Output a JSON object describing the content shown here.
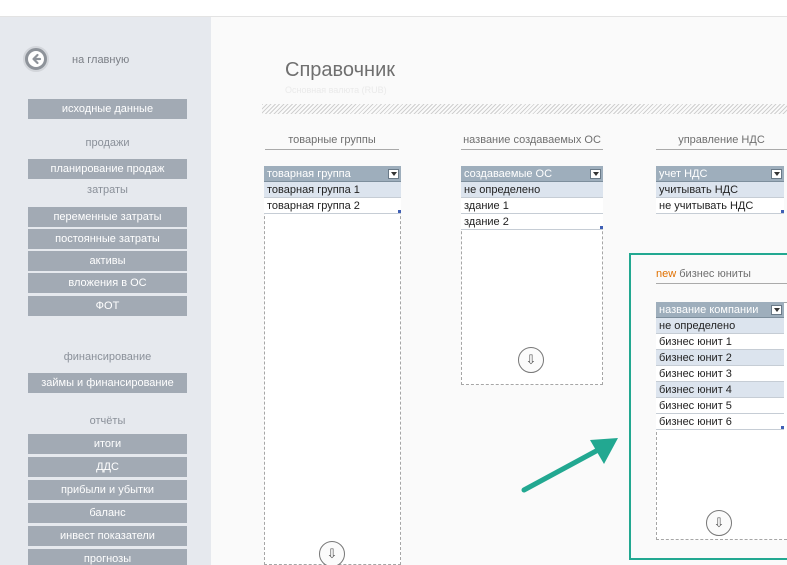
{
  "nav": {
    "home_label": "на главную",
    "initial_data": "исходные данные",
    "sales_header": "продажи",
    "sales_planning": "планирование продаж",
    "costs_header": "затраты",
    "variable_costs": "переменные затраты",
    "fixed_costs": "постоянные затраты",
    "assets": "активы",
    "fixed_asset_investment": "вложения в ОС",
    "payroll": "ФОТ",
    "financing_header": "финансирование",
    "loans_financing": "займы и финансирование",
    "reports_header": "отчёты",
    "totals": "итоги",
    "cash_flow": "ДДС",
    "profit_loss": "прибыли и убытки",
    "balance": "баланс",
    "investment_metrics": "инвест показатели",
    "forecasts": "прогнозы"
  },
  "page": {
    "title": "Справочник",
    "subtitle": "Основная валюта (RUB)"
  },
  "product_groups": {
    "heading": "товарные группы",
    "column_header": "товарная группа",
    "rows": [
      "товарная группа 1",
      "товарная группа 2"
    ]
  },
  "fixed_assets": {
    "heading": "название создаваемых ОС",
    "column_header": "создаваемые ОС",
    "rows": [
      "не определено",
      "здание 1",
      "здание 2"
    ]
  },
  "vat": {
    "heading": "управление НДС",
    "column_header": "учет НДС",
    "rows": [
      "учитывать НДС",
      "не учитывать НДС"
    ]
  },
  "business_units": {
    "new_tag": "new",
    "heading": "бизнес юниты",
    "column_header": "название компании",
    "rows": [
      "не определено",
      "бизнес юнит 1",
      "бизнес юнит 2",
      "бизнес юнит 3",
      "бизнес юнит 4",
      "бизнес юнит 5",
      "бизнес юнит 6"
    ]
  },
  "icons": {
    "home": "arrow-left-icon",
    "add_row": "arrow-down-icon",
    "dropdown": "filter-dropdown-icon"
  },
  "colors": {
    "sidebar_bg": "#e6e9ee",
    "sidebar_button": "#a2aab4",
    "table_header": "#9eaebc",
    "row_band": "#dce4ee",
    "highlight_frame": "#22a891",
    "new_tag": "#e07000"
  }
}
